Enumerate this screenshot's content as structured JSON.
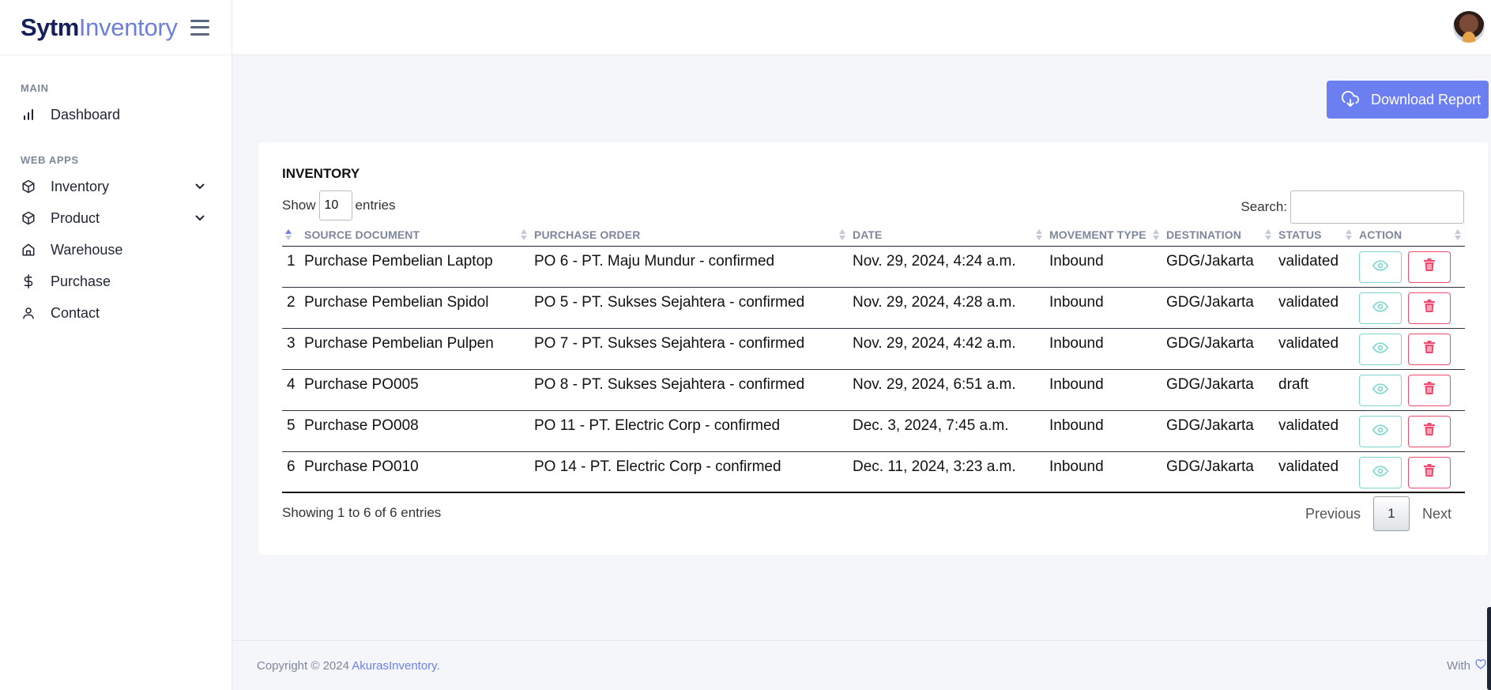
{
  "brand": {
    "strong": "Sytm",
    "light": "Inventory"
  },
  "sidebar": {
    "sections": [
      {
        "title": "MAIN",
        "items": [
          {
            "label": "Dashboard",
            "icon": "bar-chart-icon"
          }
        ]
      },
      {
        "title": "WEB APPS",
        "items": [
          {
            "label": "Inventory",
            "icon": "box-icon",
            "expandable": true
          },
          {
            "label": "Product",
            "icon": "box-icon",
            "expandable": true
          },
          {
            "label": "Warehouse",
            "icon": "home-icon"
          },
          {
            "label": "Purchase",
            "icon": "dollar-icon"
          },
          {
            "label": "Contact",
            "icon": "user-icon"
          }
        ]
      }
    ]
  },
  "toolbar": {
    "download_label": "Download Report"
  },
  "card": {
    "title": "INVENTORY",
    "show_label": "Show",
    "entries_label": "entries",
    "page_length": "10",
    "search_label": "Search:",
    "search_value": ""
  },
  "table": {
    "columns": [
      "SOURCE DOCUMENT",
      "PURCHASE ORDER",
      "DATE",
      "MOVEMENT TYPE",
      "DESTINATION",
      "STATUS",
      "ACTION"
    ],
    "rows": [
      {
        "no": "1",
        "source": "Purchase Pembelian Laptop",
        "po": "PO 6 - PT. Maju Mundur - confirmed",
        "date": "Nov. 29, 2024, 4:24 a.m.",
        "type": "Inbound",
        "dest": "GDG/Jakarta",
        "status": "validated"
      },
      {
        "no": "2",
        "source": "Purchase Pembelian Spidol",
        "po": "PO 5 - PT. Sukses Sejahtera - confirmed",
        "date": "Nov. 29, 2024, 4:28 a.m.",
        "type": "Inbound",
        "dest": "GDG/Jakarta",
        "status": "validated"
      },
      {
        "no": "3",
        "source": "Purchase Pembelian Pulpen",
        "po": "PO 7 - PT. Sukses Sejahtera - confirmed",
        "date": "Nov. 29, 2024, 4:42 a.m.",
        "type": "Inbound",
        "dest": "GDG/Jakarta",
        "status": "validated"
      },
      {
        "no": "4",
        "source": "Purchase PO005",
        "po": "PO 8 - PT. Sukses Sejahtera - confirmed",
        "date": "Nov. 29, 2024, 6:51 a.m.",
        "type": "Inbound",
        "dest": "GDG/Jakarta",
        "status": "draft"
      },
      {
        "no": "5",
        "source": "Purchase PO008",
        "po": "PO 11 - PT. Electric Corp - confirmed",
        "date": "Dec. 3, 2024, 7:45 a.m.",
        "type": "Inbound",
        "dest": "GDG/Jakarta",
        "status": "validated"
      },
      {
        "no": "6",
        "source": "Purchase PO010",
        "po": "PO 14 - PT. Electric Corp - confirmed",
        "date": "Dec. 11, 2024, 3:23 a.m.",
        "type": "Inbound",
        "dest": "GDG/Jakarta",
        "status": "validated"
      }
    ]
  },
  "pagination": {
    "info": "Showing 1 to 6 of 6 entries",
    "previous": "Previous",
    "current": "1",
    "next": "Next"
  },
  "footer": {
    "copyright": "Copyright © 2024 ",
    "link": "AkurasInventory.",
    "with": "With"
  },
  "colors": {
    "accent": "#6b7ff0",
    "view": "#7fd6cf",
    "delete": "#f04a6e",
    "brand_dark": "#141f5c"
  }
}
